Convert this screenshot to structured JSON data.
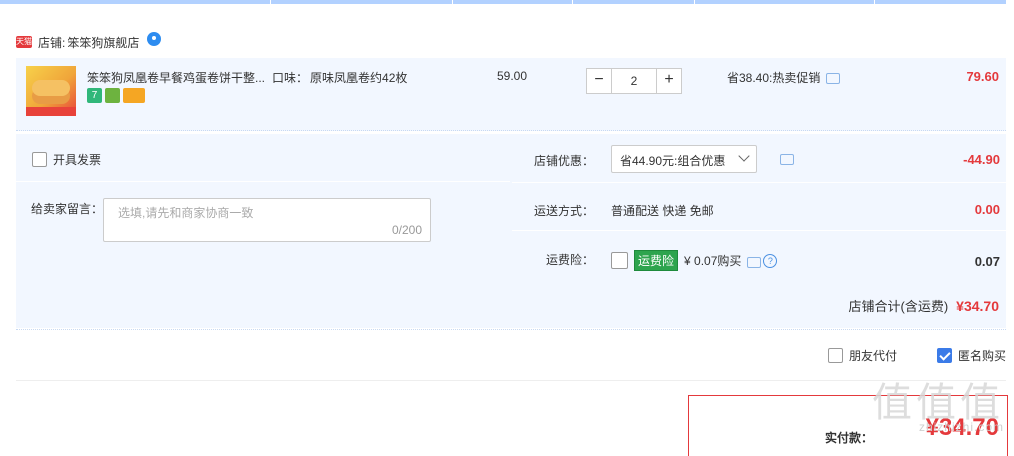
{
  "shop": {
    "badge": "天猫",
    "label": "店铺:",
    "name": "笨笨狗旗舰店"
  },
  "item": {
    "title": "笨笨狗凤凰卷早餐鸡蛋卷饼干整...",
    "flavor_key": "口味：",
    "flavor_value": "原味凤凰卷约42枚",
    "unit_price": "59.00",
    "quantity": "2",
    "minus": "−",
    "plus": "+",
    "saving": "省38.40:热卖促销",
    "total": "79.60",
    "badges": [
      "7",
      "",
      ""
    ]
  },
  "invoice": {
    "label": "开具发票"
  },
  "note": {
    "label": "给卖家留言：",
    "placeholder": "选填,请先和商家协商一致",
    "count": "0/200"
  },
  "shop_discount": {
    "label": "店铺优惠：",
    "selected": "省44.90元:组合优惠",
    "amount": "-44.90"
  },
  "shipping": {
    "label": "运送方式：",
    "value": "普通配送 快递 免邮",
    "amount": "0.00"
  },
  "insurance": {
    "label": "运费险：",
    "tag": "运费险",
    "price": "¥ 0.07购买",
    "amount": "0.07"
  },
  "subtotal": {
    "label": "店铺合计(含运费)",
    "value": "¥34.70"
  },
  "options": {
    "friend_pay": "朋友代付",
    "anonymous": "匿名购买"
  },
  "payment": {
    "label": "实付款：",
    "value": "¥34.70"
  },
  "watermark": {
    "main": "值值值",
    "sub": "zhizhizhi.com"
  },
  "colors": {
    "accent_red": "#e4393c",
    "panel_bg": "#f2f7ff",
    "link_blue": "#3b7be8"
  }
}
